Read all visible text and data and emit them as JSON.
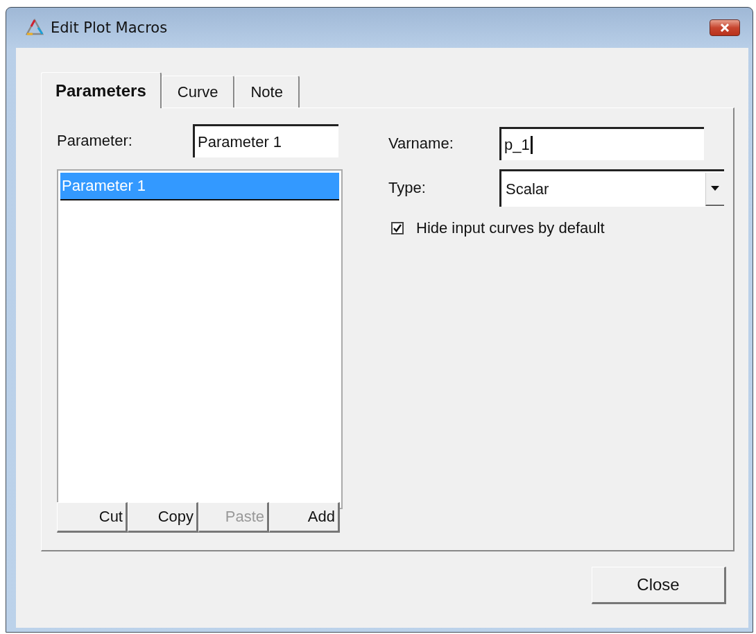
{
  "window": {
    "title": "Edit Plot Macros"
  },
  "tabs": [
    {
      "label": "Parameters",
      "selected": true
    },
    {
      "label": "Curve",
      "selected": false
    },
    {
      "label": "Note",
      "selected": false
    }
  ],
  "parameter": {
    "label": "Parameter:",
    "value": "Parameter 1"
  },
  "parameter_list": [
    {
      "label": "Parameter 1",
      "selected": true
    }
  ],
  "list_buttons": [
    {
      "label": "Cut",
      "disabled": false
    },
    {
      "label": "Copy",
      "disabled": false
    },
    {
      "label": "Paste",
      "disabled": true
    },
    {
      "label": "Add",
      "disabled": false
    }
  ],
  "varname": {
    "label": "Varname:",
    "value": "p_1"
  },
  "type": {
    "label": "Type:",
    "value": "Scalar"
  },
  "hide_input": {
    "label": "Hide input curves by default",
    "checked": true
  },
  "buttons": [
    "Close"
  ]
}
